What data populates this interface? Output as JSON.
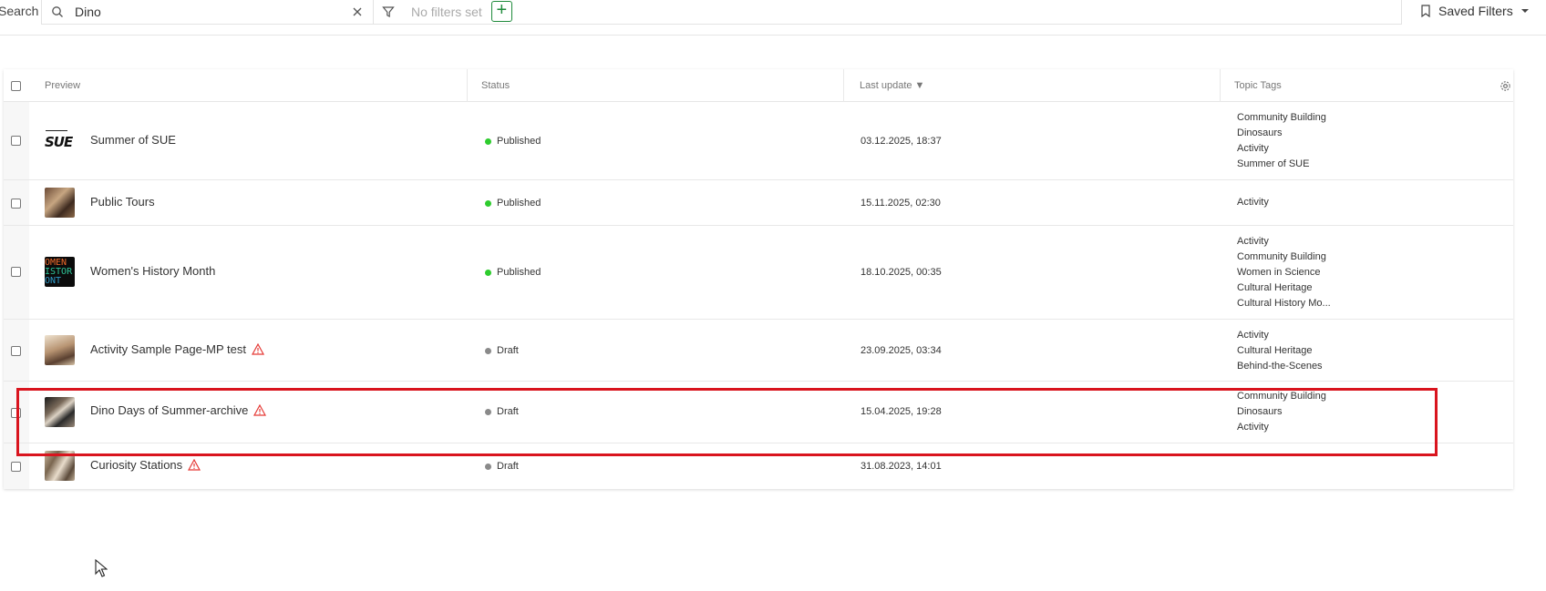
{
  "search": {
    "label": "Search",
    "value": "Dino",
    "filter_placeholder": "No filters set",
    "saved_filters_label": "Saved Filters"
  },
  "table": {
    "headers": {
      "preview": "Preview",
      "status": "Status",
      "last_update": "Last update ▼",
      "topic_tags": "Topic Tags"
    },
    "rows": [
      {
        "title": "Summer of SUE",
        "status": "Published",
        "date": "03.12.2025, 18:37",
        "tags": [
          "Community Building",
          "Dinosaurs",
          "Activity",
          "Summer of SUE"
        ],
        "warning": false
      },
      {
        "title": "Public Tours",
        "status": "Published",
        "date": "15.11.2025, 02:30",
        "tags": [
          "Activity"
        ],
        "warning": false
      },
      {
        "title": "Women's History Month",
        "status": "Published",
        "date": "18.10.2025, 00:35",
        "tags": [
          "Activity",
          "Community Building",
          "Women in Science",
          "Cultural Heritage",
          "Cultural History Mo..."
        ],
        "warning": false
      },
      {
        "title": "Activity Sample Page-MP test",
        "status": "Draft",
        "date": "23.09.2025, 03:34",
        "tags": [
          "Activity",
          "Cultural Heritage",
          "Behind-the-Scenes"
        ],
        "warning": true
      },
      {
        "title": "Dino Days of Summer-archive",
        "status": "Draft",
        "date": "15.04.2025, 19:28",
        "tags": [
          "Community Building",
          "Dinosaurs",
          "Activity"
        ],
        "warning": true
      },
      {
        "title": "Curiosity Stations",
        "status": "Draft",
        "date": "31.08.2023, 14:01",
        "tags": [],
        "warning": true
      }
    ]
  },
  "thumb_text": {
    "sue": "SUE",
    "whm": [
      "OMEN",
      "ISTOR",
      "ONT"
    ]
  },
  "colors": {
    "published": "#2ecc2e",
    "draft": "#8a8a8a",
    "warning": "#e53935",
    "add_button": "#1e8a3a",
    "highlight": "#d9141e"
  }
}
